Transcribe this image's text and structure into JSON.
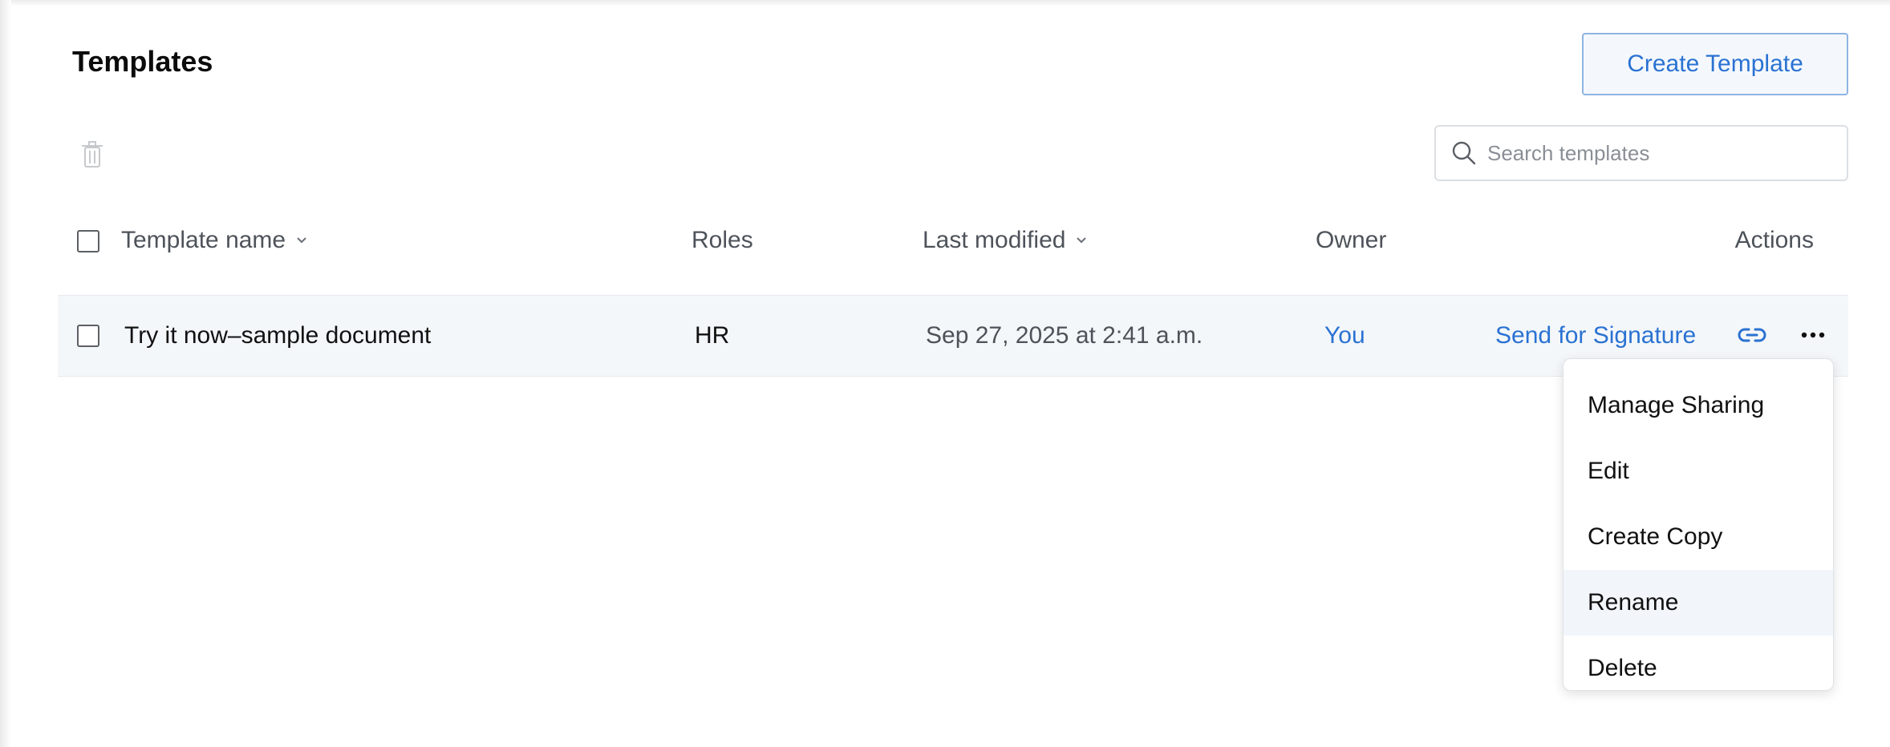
{
  "page": {
    "title": "Templates",
    "create_button": "Create Template"
  },
  "search": {
    "placeholder": "Search templates"
  },
  "table": {
    "columns": {
      "name": "Template name",
      "roles": "Roles",
      "modified": "Last modified",
      "owner": "Owner",
      "actions": "Actions"
    },
    "rows": [
      {
        "name": "Try it now–sample document",
        "roles": "HR",
        "modified": "Sep 27, 2025 at 2:41 a.m.",
        "owner": "You",
        "action": "Send for Signature"
      }
    ]
  },
  "menu": {
    "items": [
      "Manage Sharing",
      "Edit",
      "Create Copy",
      "Rename",
      "Delete"
    ],
    "highlighted": "Rename"
  },
  "colors": {
    "accent": "#2a72d2",
    "row_bg": "#f4f7fa"
  },
  "icons": [
    "trash-icon",
    "search-icon",
    "chevron-down-icon",
    "link-icon",
    "more-icon"
  ]
}
